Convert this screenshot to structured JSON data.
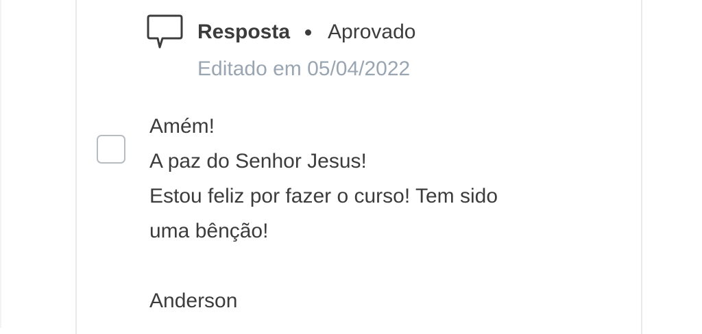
{
  "reply": {
    "author_label": "Resposta",
    "status": "Aprovado",
    "edited_text": "Editado em 05/04/2022",
    "icon": "comment-icon",
    "body_lines": [
      "Amém!",
      "A paz do Senhor Jesus!",
      "Estou feliz por fazer o curso! Tem sido",
      "uma bênção!",
      "",
      "Anderson"
    ]
  },
  "colors": {
    "text": "#3c3c3c",
    "muted": "#9aa5b2",
    "border": "#e9e9ec",
    "checkbox_border": "#b7bcc3"
  }
}
